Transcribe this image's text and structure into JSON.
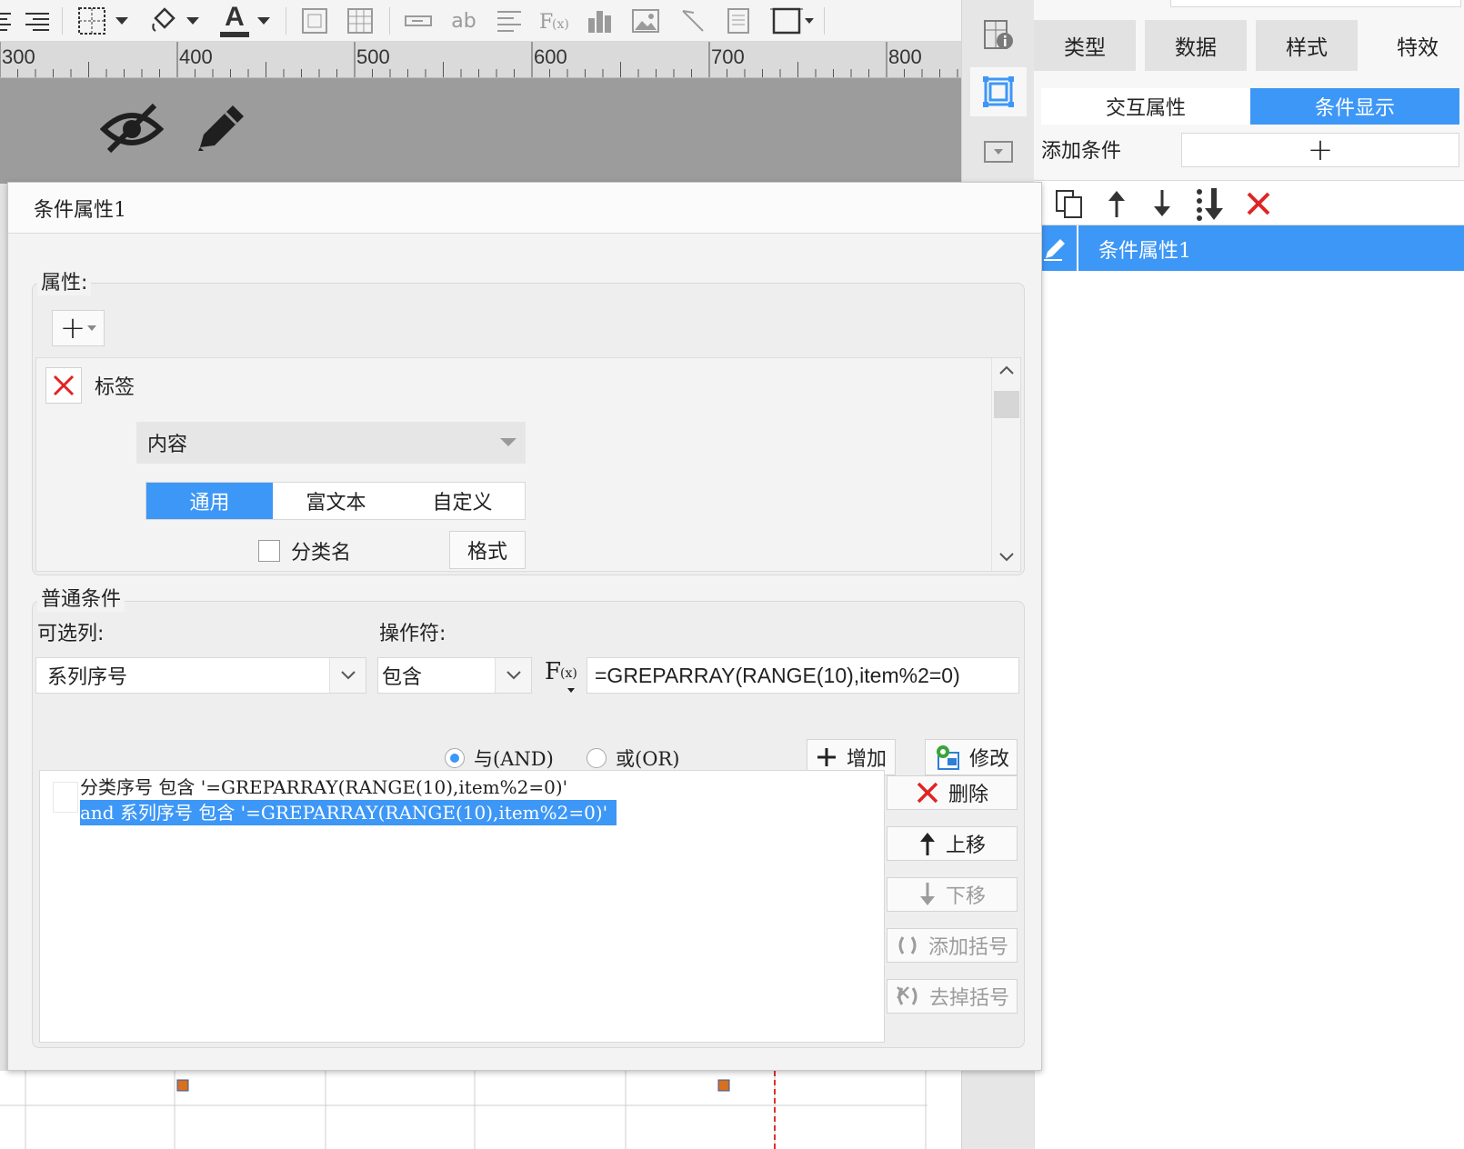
{
  "toolbar": {
    "icons": [
      "align-left-icon",
      "align-right-icon",
      "border-icon",
      "dropdown-arrow-icon",
      "fill-color-icon",
      "dropdown-arrow-icon",
      "font-color-icon",
      "dropdown-arrow-icon",
      "text-field-icon",
      "table-icon",
      "input-icon",
      "text-icon",
      "align-icon",
      "formula-icon",
      "chart-icon",
      "image-icon",
      "slash-icon",
      "document-icon",
      "frame-icon"
    ],
    "text_label": "ab",
    "font_letter": "A"
  },
  "ruler": {
    "labels": [
      "300",
      "400",
      "500",
      "600",
      "700",
      "800"
    ]
  },
  "side_strip": {
    "icons": [
      "cell-info-icon",
      "cell-select-icon",
      "dropdown-panel-icon"
    ]
  },
  "right_panel": {
    "search_placeholder": "",
    "tabs": [
      "类型",
      "数据",
      "样式",
      "特效"
    ],
    "subtabs": [
      "交互属性",
      "条件显示"
    ],
    "active_subtab": "条件显示",
    "add_condition_label": "添加条件",
    "add_symbol": "+",
    "condition_list": [
      {
        "name": "条件属性1",
        "selected": true
      }
    ]
  },
  "dialog": {
    "title": "条件属性1",
    "attributes_legend": "属性:",
    "attr_add_symbol": "+",
    "attribute_item": {
      "name": "标签",
      "content_label": "内容",
      "segments": [
        "通用",
        "富文本",
        "自定义"
      ],
      "active_segment": "通用",
      "checkbox_label": "分类名",
      "format_button": "格式"
    },
    "normal_conditions_legend": "普通条件",
    "columns_label": "可选列:",
    "operator_label": "操作符:",
    "column_value": "系列序号",
    "operator_value": "包含",
    "formula_label": "F(x)",
    "formula_value": "=GREPARRAY(RANGE(10),item%2=0)",
    "radio_and": "与(AND)",
    "radio_or": "或(OR)",
    "radio_selected": "and",
    "add_button": "增加",
    "modify_button": "修改",
    "delete_button": "删除",
    "move_up_button": "上移",
    "move_down_button": "下移",
    "add_paren_button": "添加括号",
    "remove_paren_button": "去掉括号",
    "conditions": [
      {
        "text": "分类序号 包含 '=GREPARRAY(RANGE(10),item%2=0)'",
        "selected": false
      },
      {
        "text": "and 系列序号 包含 '=GREPARRAY(RANGE(10),item%2=0)'",
        "selected": true
      }
    ]
  },
  "colors": {
    "accent": "#3d97f6",
    "delete_red": "#e02424"
  }
}
